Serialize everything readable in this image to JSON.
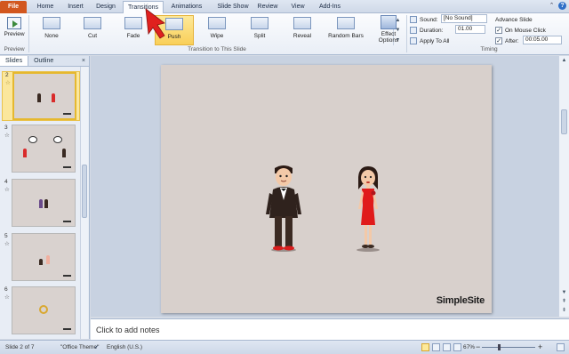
{
  "tabs": [
    {
      "label": "File"
    },
    {
      "label": "Home"
    },
    {
      "label": "Insert"
    },
    {
      "label": "Design"
    },
    {
      "label": "Transitions"
    },
    {
      "label": "Animations"
    },
    {
      "label": "Slide Show"
    },
    {
      "label": "Review"
    },
    {
      "label": "View"
    },
    {
      "label": "Add-Ins"
    }
  ],
  "ribbon": {
    "preview_label": "Preview",
    "preview_group": "Preview",
    "transitions": [
      {
        "label": "None"
      },
      {
        "label": "Cut"
      },
      {
        "label": "Fade"
      },
      {
        "label": "Push"
      },
      {
        "label": "Wipe"
      },
      {
        "label": "Split"
      },
      {
        "label": "Reveal"
      },
      {
        "label": "Random Bars"
      }
    ],
    "selected_transition": "Push",
    "transition_group": "Transition to This Slide",
    "effect_options_line1": "Effect",
    "effect_options_line2": "Options",
    "timing": {
      "sound_label": "Sound:",
      "sound_value": "[No Sound]",
      "duration_label": "Duration:",
      "duration_value": "01.00",
      "apply_all_label": "Apply To All",
      "advance_label": "Advance Slide",
      "on_click_label": "On Mouse Click",
      "on_click_checked": true,
      "after_label": "After:",
      "after_checked": true,
      "after_value": "00:05.00",
      "group_label": "Timing"
    }
  },
  "left_pane": {
    "tabs": [
      {
        "label": "Slides"
      },
      {
        "label": "Outline"
      }
    ],
    "close_glyph": "×",
    "thumbnails": [
      {
        "num": "2",
        "selected": true
      },
      {
        "num": "3",
        "selected": false
      },
      {
        "num": "4",
        "selected": false
      },
      {
        "num": "5",
        "selected": false
      },
      {
        "num": "6",
        "selected": false
      }
    ]
  },
  "slide": {
    "logo_text": "SimpleSite"
  },
  "notes": {
    "placeholder": "Click to add notes"
  },
  "status": {
    "slide_info": "Slide 2 of 7",
    "theme": "\"Office Theme\"",
    "language": "English (U.S.)",
    "zoom_percent": "67%",
    "zoom_level": 0.67
  },
  "colors": {
    "file_tab": "#d2571f",
    "selection": "#f9cf59",
    "slide_bg": "#d8d0cc",
    "red_arrow": "#e0201e"
  }
}
